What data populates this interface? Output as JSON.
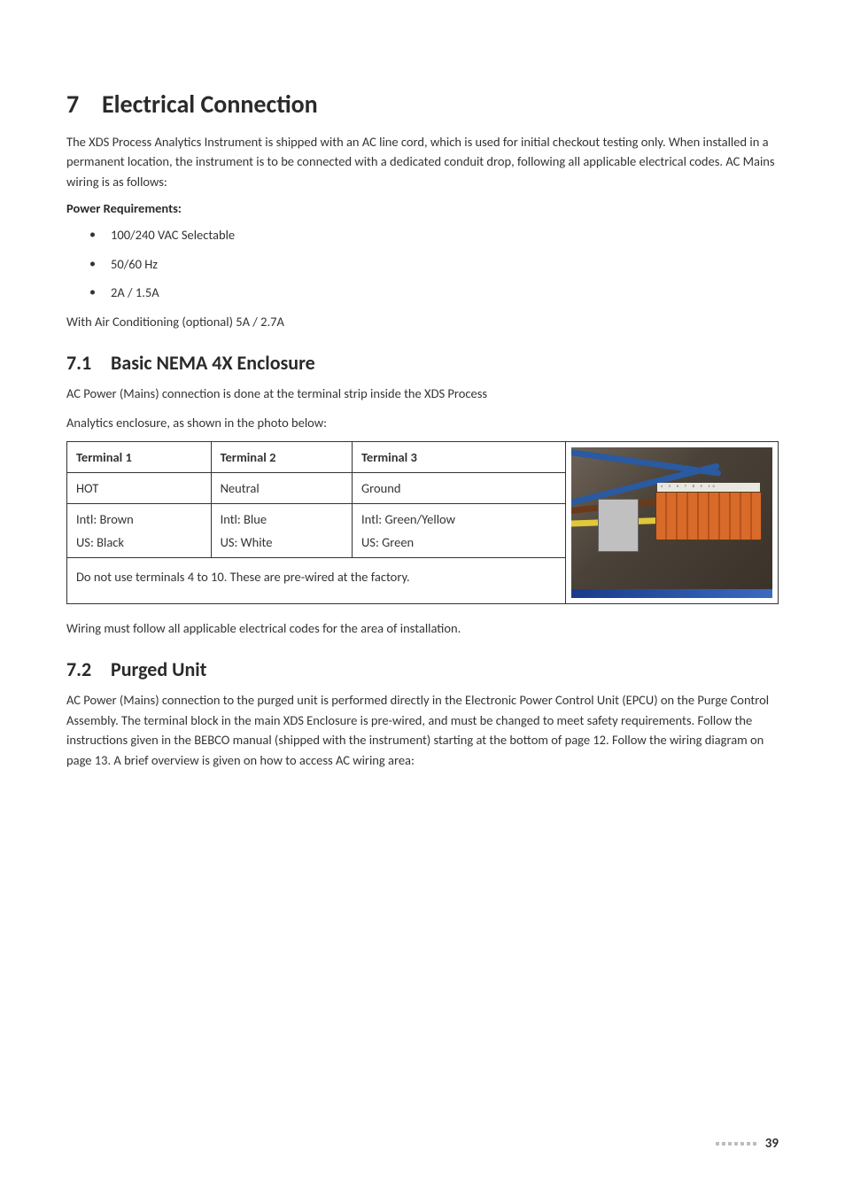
{
  "chapter": {
    "number": "7",
    "title": "Electrical Connection"
  },
  "intro": "The XDS Process Analytics Instrument is shipped with an AC line cord, which is used for initial checkout testing only. When installed in a permanent location, the instrument is to be connected with a dedicated conduit drop, following all applicable electrical codes. AC Mains wiring is as follows:",
  "power_req_label": "Power Requirements:",
  "power_req_items": [
    "100/240 VAC Selectable",
    "50/60 Hz",
    "2A / 1.5A"
  ],
  "air_cond": "With Air Conditioning (optional) 5A / 2.7A",
  "section_7_1": {
    "number": "7.1",
    "title": "Basic NEMA 4X Enclosure"
  },
  "s71_p1": "AC Power (Mains) connection is done at the terminal strip inside the XDS Process",
  "s71_p2": "Analytics enclosure, as shown in the photo below:",
  "table": {
    "headers": [
      "Terminal 1",
      "Terminal 2",
      "Terminal 3"
    ],
    "row1": [
      "HOT",
      "Neutral",
      "Ground"
    ],
    "row2": [
      "Intl: Brown",
      "Intl: Blue",
      "Intl: Green/Yellow"
    ],
    "row3": [
      "US: Black",
      "US: White",
      "US: Green"
    ],
    "note": "Do not use terminals 4 to 10. These are pre-wired at the factory."
  },
  "s71_p3": "Wiring must follow all applicable electrical codes for the area of installation.",
  "section_7_2": {
    "number": "7.2",
    "title": "Purged Unit"
  },
  "s72_p1": "AC Power (Mains) connection to the purged unit is performed directly in the Electronic Power Control Unit (EPCU) on the Purge Control Assembly. The terminal block in the main XDS Enclosure is pre-wired, and must be changed to meet safety requirements. Follow the instructions given in the BEBCO manual (shipped with the instrument) starting at the bottom of page 12. Follow the wiring diagram on page 13. A brief overview is given on how to access AC wiring area:",
  "page_number": "39",
  "photo_terminal_labels": "4  5  6  7  8  9  10"
}
